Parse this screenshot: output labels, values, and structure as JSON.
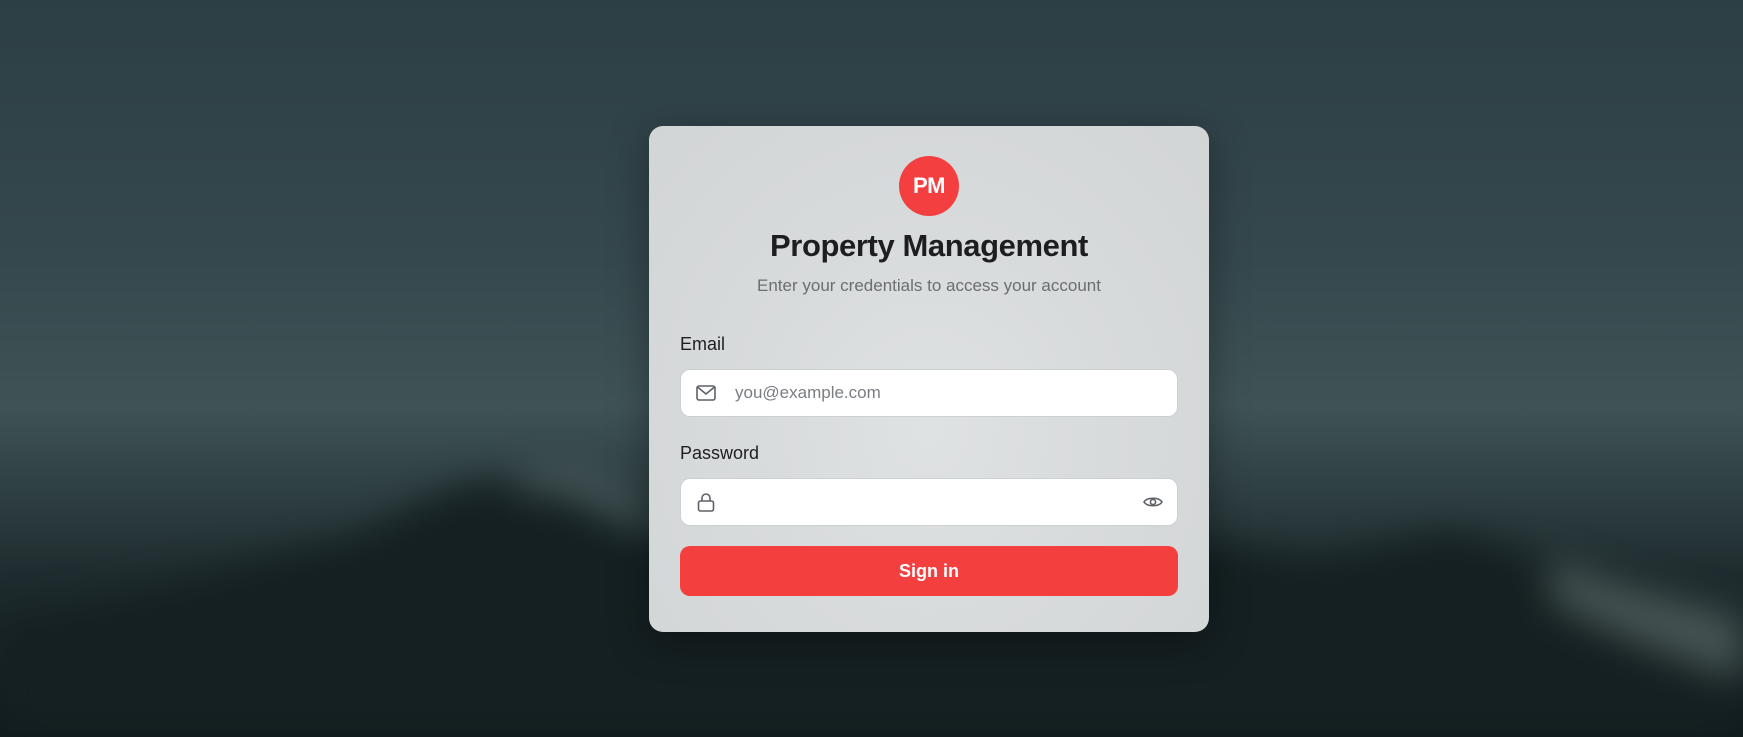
{
  "brand": {
    "initials": "PM",
    "color": "#f43f3f"
  },
  "header": {
    "title": "Property Management",
    "subtitle": "Enter your credentials to access your account"
  },
  "email": {
    "label": "Email",
    "placeholder": "you@example.com",
    "value": "",
    "icon": "mail-icon"
  },
  "password": {
    "label": "Password",
    "placeholder": "",
    "value": "",
    "icon": "lock-icon",
    "toggle_icon": "eye-icon"
  },
  "submit": {
    "label": "Sign in"
  }
}
